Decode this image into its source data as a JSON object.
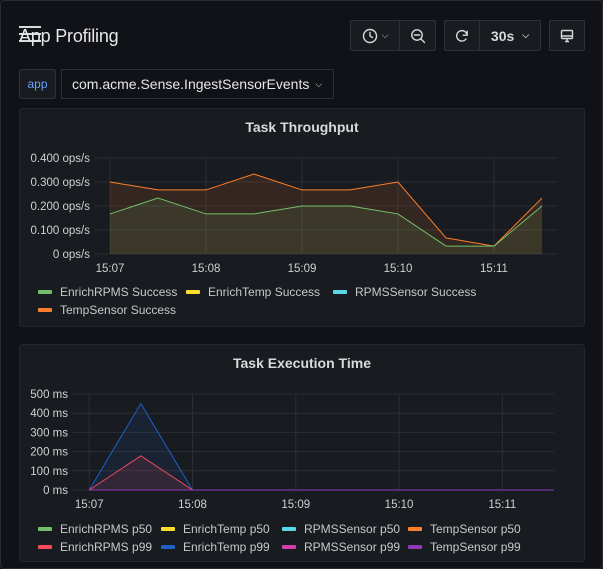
{
  "header": {
    "title": "App Profiling",
    "refresh_interval": "30s"
  },
  "variables": {
    "label": "app",
    "value": "com.acme.Sense.IngestSensorEvents"
  },
  "colors": {
    "green": "#73bf69",
    "yellow": "#f2cc0c",
    "cyan": "#5ad8e6",
    "orange": "#ff9830",
    "red": "#f2495c",
    "blue": "#1f60c4",
    "pink": "#d43dae",
    "purple": "#8f3bb8",
    "accent": "#6e9fff"
  },
  "panels": [
    {
      "title": "Task Throughput",
      "legend": [
        {
          "label": "EnrichRPMS Success",
          "color": "#73bf69"
        },
        {
          "label": "EnrichTemp Success",
          "color": "#fade2a"
        },
        {
          "label": "RPMSSensor Success",
          "color": "#5ad8e6"
        },
        {
          "label": "TempSensor Success",
          "color": "#ff7f2a"
        }
      ]
    },
    {
      "title": "Task Execution Time",
      "legend": [
        {
          "label": "EnrichRPMS p50",
          "color": "#73bf69"
        },
        {
          "label": "EnrichTemp p50",
          "color": "#fade2a"
        },
        {
          "label": "RPMSSensor p50",
          "color": "#5ad8e6"
        },
        {
          "label": "TempSensor p50",
          "color": "#ff7f2a"
        },
        {
          "label": "EnrichRPMS p99",
          "color": "#f2495c"
        },
        {
          "label": "EnrichTemp p99",
          "color": "#1f60c4"
        },
        {
          "label": "RPMSSensor p99",
          "color": "#d43dae"
        },
        {
          "label": "TempSensor p99",
          "color": "#8f3bb8"
        }
      ]
    }
  ],
  "chart_data": [
    {
      "type": "area",
      "title": "Task Throughput",
      "x_ticks": [
        "15:07",
        "15:08",
        "15:09",
        "15:10",
        "15:11"
      ],
      "y_ticks": [
        "0 ops/s",
        "0.100 ops/s",
        "0.200 ops/s",
        "0.300 ops/s",
        "0.400 ops/s"
      ],
      "ylim": [
        0,
        0.4
      ],
      "xlim": [
        "15:06:50",
        "15:11:40"
      ],
      "x": [
        "15:07:00",
        "15:07:30",
        "15:08:00",
        "15:08:30",
        "15:09:00",
        "15:09:30",
        "15:10:00",
        "15:10:30",
        "15:11:00",
        "15:11:30"
      ],
      "series": [
        {
          "name": "TempSensor Success",
          "color": "#ff7f2a",
          "values": [
            0.3,
            0.267,
            0.267,
            0.333,
            0.267,
            0.267,
            0.3,
            0.067,
            0.033,
            0.233
          ]
        },
        {
          "name": "EnrichRPMS Success",
          "color": "#73bf69",
          "values": [
            0.167,
            0.233,
            0.167,
            0.167,
            0.2,
            0.2,
            0.167,
            0.033,
            0.033,
            0.2
          ]
        }
      ],
      "grid": true,
      "legend_position": "bottom"
    },
    {
      "type": "area",
      "title": "Task Execution Time",
      "x_ticks": [
        "15:07",
        "15:08",
        "15:09",
        "15:10",
        "15:11"
      ],
      "y_ticks": [
        "0 ms",
        "100 ms",
        "200 ms",
        "300 ms",
        "400 ms",
        "500 ms"
      ],
      "ylim": [
        0,
        500
      ],
      "xlim": [
        "15:06:50",
        "15:11:30"
      ],
      "x": [
        "15:07:00",
        "15:07:30",
        "15:08:00",
        "15:11:30"
      ],
      "series": [
        {
          "name": "EnrichTemp p99",
          "color": "#1f60c4",
          "values": [
            0,
            450,
            0,
            0
          ]
        },
        {
          "name": "EnrichRPMS p99",
          "color": "#f2495c",
          "values": [
            0,
            178,
            0,
            0
          ]
        },
        {
          "name": "TempSensor p99",
          "color": "#8f3bb8",
          "values": [
            0,
            0,
            0,
            0
          ]
        }
      ],
      "grid": true,
      "legend_position": "bottom"
    }
  ]
}
